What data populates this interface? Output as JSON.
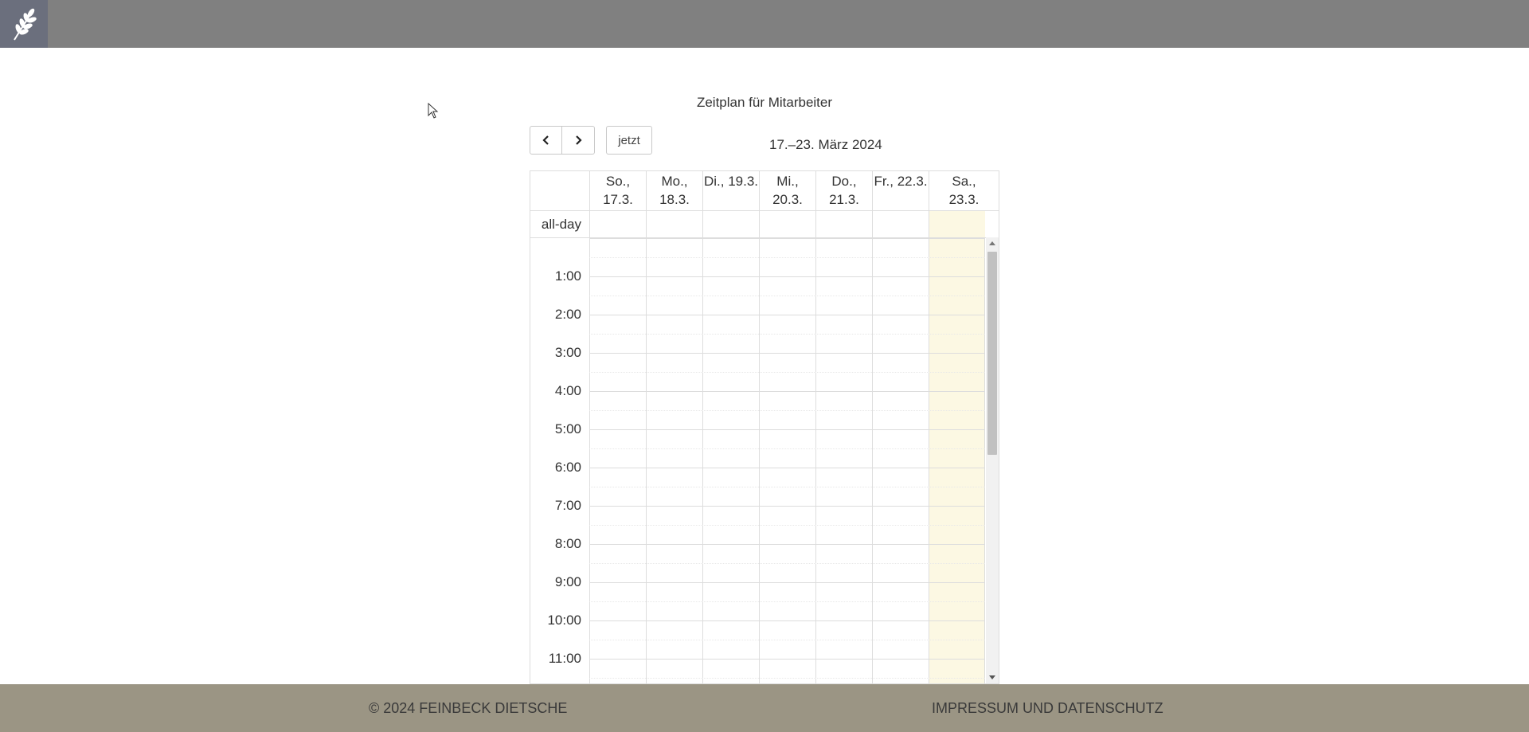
{
  "page": {
    "title": "Zeitplan für Mitarbeiter"
  },
  "toolbar": {
    "today_label": "jetzt",
    "range_title": "17.–23. März 2024"
  },
  "calendar": {
    "allday_label": "all-day",
    "days": [
      {
        "line1": "So., 17.3.",
        "line2": ""
      },
      {
        "line1": "Mo.,",
        "line2": "18.3."
      },
      {
        "line1": "Di., 19.3.",
        "line2": ""
      },
      {
        "line1": "Mi.,",
        "line2": "20.3."
      },
      {
        "line1": "Do.,",
        "line2": "21.3."
      },
      {
        "line1": "Fr., 22.3.",
        "line2": ""
      },
      {
        "line1": "Sa.,",
        "line2": "23.3."
      }
    ],
    "highlighted_day": 6,
    "times": [
      "1:00",
      "2:00",
      "3:00",
      "4:00",
      "5:00",
      "6:00",
      "7:00",
      "8:00",
      "9:00",
      "10:00",
      "11:00"
    ]
  },
  "footer": {
    "copyright": "© 2024 FEINBECK DIETSCHE",
    "link": "IMPRESSUM UND DATENSCHUTZ"
  },
  "colors": {
    "topbar": "#808080",
    "footer": "#9b9584",
    "today_highlight": "#fcf8e3"
  }
}
